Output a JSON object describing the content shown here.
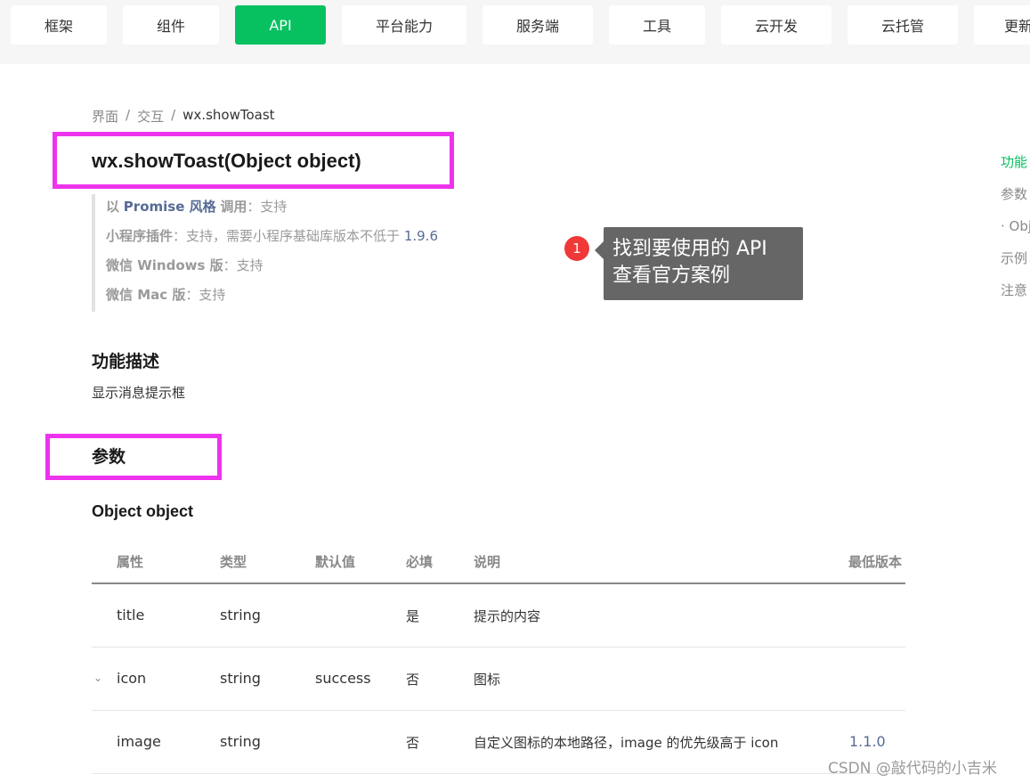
{
  "nav": {
    "items": [
      {
        "label": "框架"
      },
      {
        "label": "组件"
      },
      {
        "label": "API",
        "active": true
      },
      {
        "label": "平台能力"
      },
      {
        "label": "服务端"
      },
      {
        "label": "工具"
      },
      {
        "label": "云开发"
      },
      {
        "label": "云托管"
      },
      {
        "label": "更新"
      }
    ],
    "accent_color": "#07c160"
  },
  "breadcrumb": {
    "items": [
      "界面",
      "交互",
      "wx.showToast"
    ],
    "separator": "/"
  },
  "page_title": "wx.showToast(Object object)",
  "support": {
    "promise": {
      "prefix": "以",
      "name": "Promise 风格",
      "suffix": "调用",
      "value": "支持"
    },
    "plugin": {
      "label": "小程序插件",
      "value": "支持，需要小程序基础库版本不低于",
      "version": "1.9.6"
    },
    "windows": {
      "label": "微信 Windows 版",
      "value": "支持"
    },
    "mac": {
      "label": "微信 Mac 版",
      "value": "支持"
    }
  },
  "annotation": {
    "number": "1",
    "line1": "找到要使用的 API",
    "line2": "查看官方案例"
  },
  "section_feature": {
    "heading": "功能描述",
    "text": "显示消息提示框"
  },
  "section_params": {
    "heading": "参数",
    "subheading": "Object object"
  },
  "table": {
    "headers": [
      "属性",
      "类型",
      "默认值",
      "必填",
      "说明",
      "最低版本"
    ],
    "rows": [
      {
        "attr": "title",
        "type": "string",
        "default": "",
        "required": "是",
        "desc": "提示的内容",
        "version": ""
      },
      {
        "attr": "icon",
        "type": "string",
        "default": "success",
        "required": "否",
        "desc": "图标",
        "version": ""
      },
      {
        "attr": "image",
        "type": "string",
        "default": "",
        "required": "否",
        "desc": "自定义图标的本地路径，image 的优先级高于 icon",
        "version": "1.1.0"
      }
    ]
  },
  "toc": {
    "items": [
      "功能",
      "参数",
      "· Obj",
      "示例",
      "注意"
    ]
  },
  "watermark": "CSDN @敲代码的小吉米",
  "colors": {
    "highlight": "#ee33ee",
    "annotation_bg": "#666666",
    "annotation_dot": "#f03838",
    "link": "#576b95"
  }
}
